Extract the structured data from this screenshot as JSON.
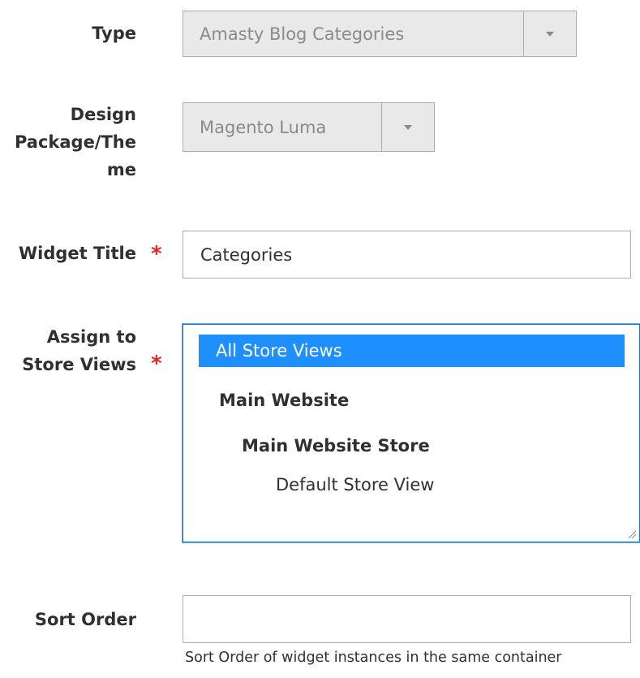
{
  "form": {
    "type": {
      "label": "Type",
      "value": "Amasty Blog Categories"
    },
    "design_package": {
      "label_lines": [
        "Design",
        "Package/The",
        "me"
      ],
      "value": "Magento Luma"
    },
    "widget_title": {
      "label": "Widget Title",
      "required_mark": "*",
      "value": "Categories"
    },
    "store_views": {
      "label_lines": [
        "Assign to",
        "Store Views"
      ],
      "required_mark": "*",
      "options": [
        {
          "label": "All Store Views",
          "selected": true
        },
        {
          "label": "Main Website",
          "group": true
        },
        {
          "label": "Main Website Store",
          "group": true
        },
        {
          "label": "Default Store View"
        }
      ]
    },
    "sort_order": {
      "label": "Sort Order",
      "value": "",
      "note": "Sort Order of widget instances in the same container"
    }
  },
  "colors": {
    "selected_option_bg": "#1e8fff",
    "required_mark": "#e22626",
    "disabled_select_bg": "#e9e9e9"
  }
}
